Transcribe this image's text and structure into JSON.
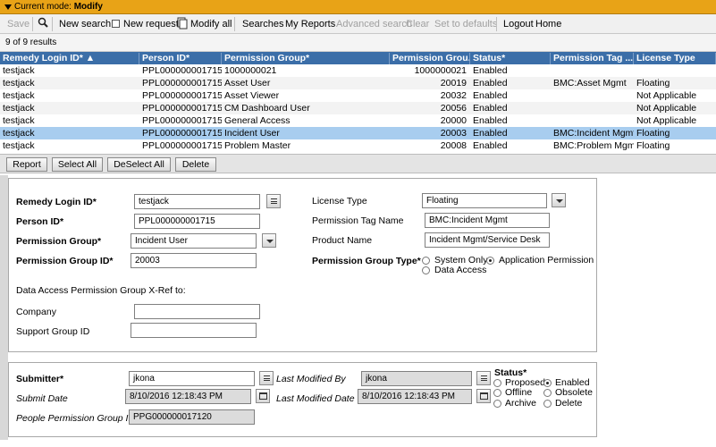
{
  "mode_bar": {
    "prefix": "Current mode:",
    "mode": "Modify"
  },
  "toolbar": {
    "save": "Save",
    "new_search": "New search",
    "new_request": "New request",
    "modify_all": "Modify all",
    "searches": "Searches",
    "my_reports": "My Reports",
    "advanced_search": "Advanced search",
    "clear": "Clear",
    "set_to_defaults": "Set to defaults",
    "logout": "Logout",
    "home": "Home"
  },
  "results": {
    "count_text": "9 of 9 results"
  },
  "grid": {
    "headers": [
      "Remedy Login ID*",
      "Person ID*",
      "Permission Group*",
      "Permission Grou...",
      "Status*",
      "Permission Tag ...",
      "License Type"
    ],
    "rows": [
      [
        "testjack",
        "PPL000000001715",
        "1000000021",
        "1000000021",
        "Enabled",
        "",
        ""
      ],
      [
        "testjack",
        "PPL000000001715",
        "Asset User",
        "20019",
        "Enabled",
        "BMC:Asset Mgmt",
        "Floating"
      ],
      [
        "testjack",
        "PPL000000001715",
        "Asset Viewer",
        "20032",
        "Enabled",
        "",
        "Not Applicable"
      ],
      [
        "testjack",
        "PPL000000001715",
        "CM Dashboard User",
        "20056",
        "Enabled",
        "",
        "Not Applicable"
      ],
      [
        "testjack",
        "PPL000000001715",
        "General Access",
        "20000",
        "Enabled",
        "",
        "Not Applicable"
      ],
      [
        "testjack",
        "PPL000000001715",
        "Incident User",
        "20003",
        "Enabled",
        "BMC:Incident Mgmt",
        "Floating"
      ],
      [
        "testjack",
        "PPL000000001715",
        "Problem Master",
        "20008",
        "Enabled",
        "BMC:Problem Mgmt",
        "Floating"
      ]
    ],
    "selected_row": 5
  },
  "buttons": {
    "report": "Report",
    "select_all": "Select All",
    "deselect_all": "DeSelect All",
    "delete": "Delete"
  },
  "form": {
    "remedy_login_id": {
      "label": "Remedy Login ID*",
      "value": "testjack"
    },
    "person_id": {
      "label": "Person ID*",
      "value": "PPL000000001715"
    },
    "permission_group": {
      "label": "Permission Group*",
      "value": "Incident User"
    },
    "permission_group_id": {
      "label": "Permission Group ID*",
      "value": "20003"
    },
    "license_type": {
      "label": "License Type",
      "value": "Floating"
    },
    "permission_tag_name": {
      "label": "Permission Tag Name",
      "value": "BMC:Incident Mgmt"
    },
    "product_name": {
      "label": "Product Name",
      "value": "Incident Mgmt/Service Desk"
    },
    "permission_group_type": {
      "label": "Permission Group Type*",
      "options": [
        "System Only",
        "Application Permission",
        "Data Access"
      ],
      "selected": "Application Permission"
    },
    "xref_label": "Data Access Permission Group X-Ref to:",
    "company": {
      "label": "Company",
      "value": ""
    },
    "support_group_id": {
      "label": "Support Group ID",
      "value": ""
    }
  },
  "audit": {
    "submitter": {
      "label": "Submitter*",
      "value": "jkona"
    },
    "last_modified_by": {
      "label": "Last Modified By",
      "value": "jkona"
    },
    "submit_date": {
      "label": "Submit Date",
      "value": "8/10/2016 12:18:43 PM"
    },
    "last_modified_date": {
      "label": "Last Modified Date",
      "value": "8/10/2016 12:18:43 PM"
    },
    "people_permission_group_id": {
      "label": "People Permission Group ID",
      "value": "PPG000000017120"
    },
    "status": {
      "label": "Status*",
      "options": [
        "Proposed",
        "Enabled",
        "Offline",
        "Obsolete",
        "Archive",
        "Delete"
      ],
      "selected": "Enabled"
    }
  },
  "colors": {
    "mode_bar": "#e8a317",
    "grid_header": "#3b6ea8",
    "selected_row": "#a8cdef"
  }
}
